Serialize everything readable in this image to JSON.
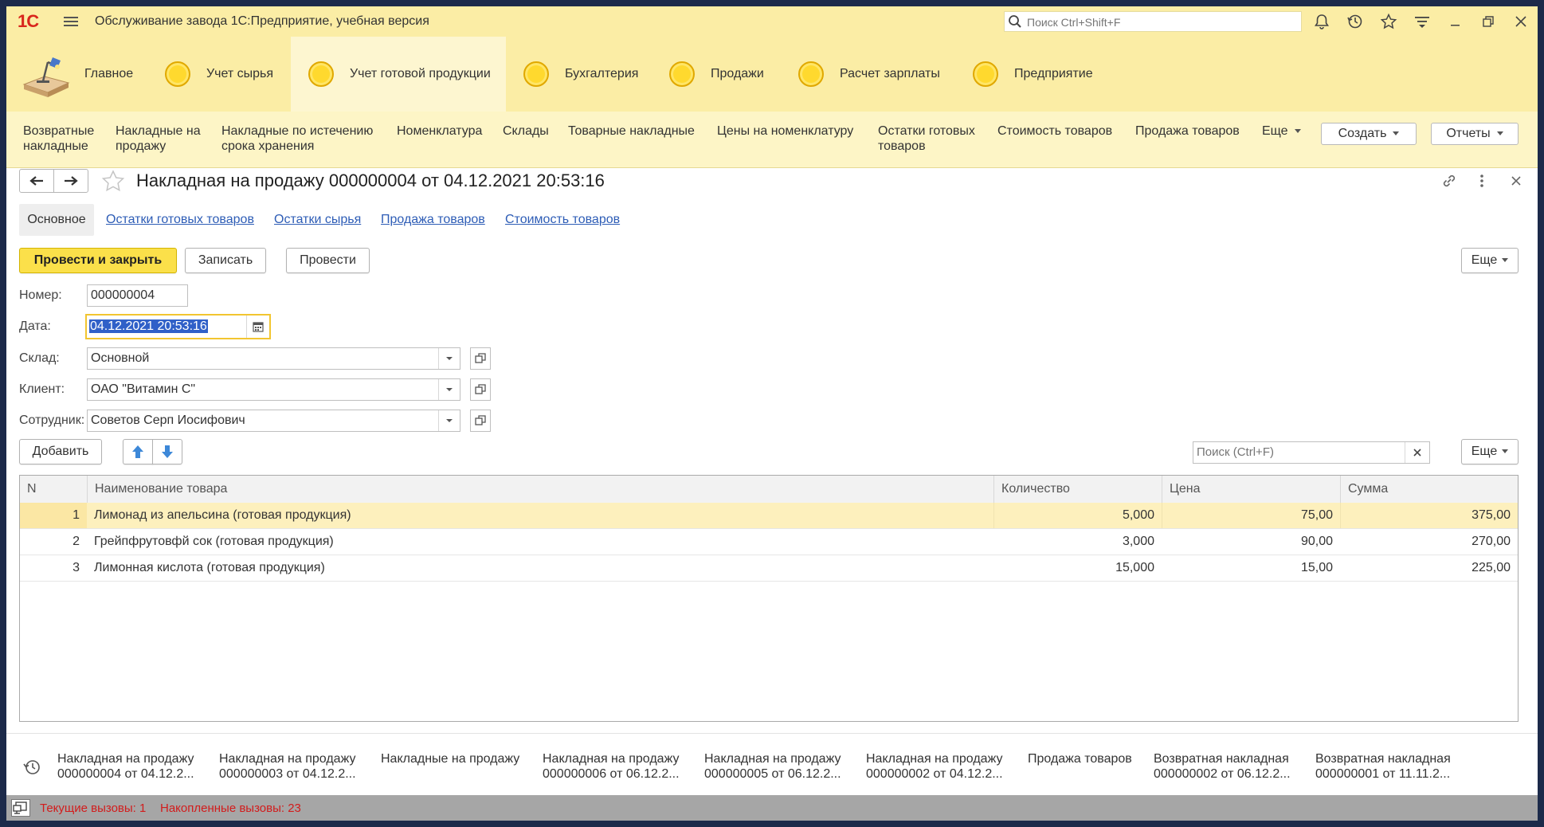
{
  "app": {
    "logo_text": "1С",
    "title": "Обслуживание завода 1С:Предприятие, учебная версия",
    "search_placeholder": "Поиск Ctrl+Shift+F"
  },
  "sections": [
    {
      "label": "Главное",
      "icon": "home-desk-lamp-icon"
    },
    {
      "label": "Учет сырья",
      "icon": "section-circle-icon"
    },
    {
      "label": "Учет готовой продукции",
      "icon": "section-circle-icon",
      "active": true
    },
    {
      "label": "Бухгалтерия",
      "icon": "section-circle-icon"
    },
    {
      "label": "Продажи",
      "icon": "section-circle-icon"
    },
    {
      "label": "Расчет зарплаты",
      "icon": "section-circle-icon"
    },
    {
      "label": "Предприятие",
      "icon": "section-circle-icon"
    }
  ],
  "function_panel": {
    "links": [
      {
        "line1": "Возвратные",
        "line2": "накладные"
      },
      {
        "line1": "Накладные на",
        "line2": "продажу"
      },
      {
        "line1": "Накладные по истечению",
        "line2": "срока хранения"
      },
      {
        "line1": "Номенклатура",
        "line2": ""
      },
      {
        "line1": "Склады",
        "line2": ""
      },
      {
        "line1": "Товарные накладные",
        "line2": ""
      },
      {
        "line1": "Цены на номенклатуру",
        "line2": ""
      },
      {
        "line1": "Остатки готовых",
        "line2": "товаров"
      },
      {
        "line1": "Стоимость товаров",
        "line2": ""
      },
      {
        "line1": "Продажа товаров",
        "line2": ""
      }
    ],
    "more_label": "Еще",
    "create_label": "Создать",
    "reports_label": "Отчеты"
  },
  "form": {
    "title": "Накладная на продажу 000000004 от 04.12.2021 20:53:16",
    "tabs": {
      "main": "Основное",
      "links": [
        "Остатки готовых товаров",
        "Остатки сырья",
        "Продажа товаров",
        "Стоимость товаров"
      ]
    },
    "commands": {
      "post_close": "Провести и закрыть",
      "save": "Записать",
      "post": "Провести",
      "more": "Еще"
    },
    "fields": {
      "number_label": "Номер:",
      "number_value": "000000004",
      "date_label": "Дата:",
      "date_value": "04.12.2021 20:53:16",
      "warehouse_label": "Склад:",
      "warehouse_value": "Основной",
      "client_label": "Клиент:",
      "client_value": "ОАО \"Витамин С\"",
      "employee_label": "Сотрудник:",
      "employee_value": "Советов Серп Иосифович"
    },
    "table_bar": {
      "add_label": "Добавить",
      "search_placeholder": "Поиск (Ctrl+F)",
      "more": "Еще"
    },
    "table": {
      "columns": [
        "N",
        "Наименование товара",
        "Количество",
        "Цена",
        "Сумма"
      ],
      "rows": [
        {
          "n": "1",
          "name": "Лимонад из апельсина (готовая продукция)",
          "qty": "5,000",
          "price": "75,00",
          "sum": "375,00"
        },
        {
          "n": "2",
          "name": "Грейпфрутовфй сок (готовая продукция)",
          "qty": "3,000",
          "price": "90,00",
          "sum": "270,00"
        },
        {
          "n": "3",
          "name": "Лимонная кислота (готовая продукция)",
          "qty": "15,000",
          "price": "15,00",
          "sum": "225,00"
        }
      ]
    }
  },
  "history": [
    {
      "line1": "Накладная на продажу",
      "line2": "000000004 от 04.12.2..."
    },
    {
      "line1": "Накладная на продажу",
      "line2": "000000003 от 04.12.2..."
    },
    {
      "line1": "Накладные на продажу",
      "line2": ""
    },
    {
      "line1": "Накладная на продажу",
      "line2": "000000006 от 06.12.2..."
    },
    {
      "line1": "Накладная на продажу",
      "line2": "000000005 от 06.12.2..."
    },
    {
      "line1": "Накладная на продажу",
      "line2": "000000002 от 04.12.2..."
    },
    {
      "line1": "Продажа товаров",
      "line2": ""
    },
    {
      "line1": "Возвратная накладная",
      "line2": "000000002 от 06.12.2..."
    },
    {
      "line1": "Возвратная накладная",
      "line2": "000000001 от 11.11.2..."
    }
  ],
  "status": {
    "current_calls": "Текущие вызовы: 1",
    "accumulated_calls": "Накопленные вызовы: 23"
  },
  "colors": {
    "accent_yellow": "#fbeda5",
    "primary_button": "#fbe04a",
    "link_blue": "#2e5db6",
    "status_red": "#d21c1c"
  }
}
